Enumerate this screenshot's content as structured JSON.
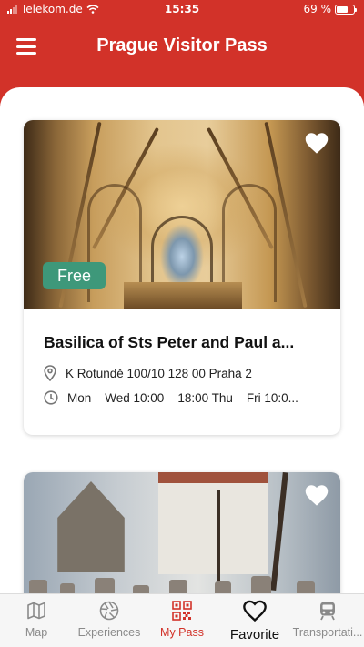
{
  "status_bar": {
    "carrier": "Telekom.de",
    "time": "15:35",
    "battery": "69 %",
    "battery_level": 0.69
  },
  "app_bar": {
    "title": "Prague Visitor Pass",
    "menu_icon": "hamburger-menu-icon"
  },
  "cards": [
    {
      "title": "Basilica of Sts Peter and Paul a...",
      "badge": "Free",
      "address": "K Rotundě 100/10  128 00  Praha 2",
      "hours": "Mon – Wed 10:00 – 18:00  Thu – Fri 10:0...",
      "favorite_icon": "heart-icon"
    },
    {
      "favorite_icon": "heart-icon"
    }
  ],
  "tabs": [
    {
      "label": "Map",
      "icon": "map-icon"
    },
    {
      "label": "Experiences",
      "icon": "aperture-icon"
    },
    {
      "label": "My Pass",
      "icon": "qr-code-icon",
      "active": true
    },
    {
      "label": "Favorite",
      "icon": "heart-outline-icon"
    },
    {
      "label": "Transportati...",
      "icon": "train-icon"
    }
  ],
  "colors": {
    "brand_red": "#d23229",
    "badge_green": "#3e987a",
    "tab_inactive": "#8a8a8a"
  }
}
